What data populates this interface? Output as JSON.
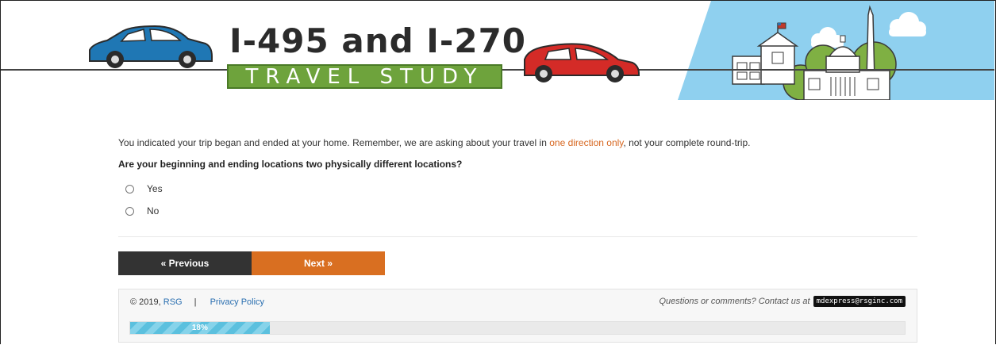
{
  "header": {
    "title_main": "I-495 and I-270",
    "title_sub": "TRAVEL STUDY"
  },
  "question": {
    "intro_before": "You indicated your trip began and ended at your home. Remember, we are asking about your travel in ",
    "intro_highlight": "one direction only",
    "intro_after": ", not your complete round-trip.",
    "text": "Are your beginning and ending locations two physically different locations?",
    "options": [
      {
        "label": "Yes",
        "selected": false
      },
      {
        "label": "No",
        "selected": false
      }
    ]
  },
  "nav": {
    "previous_label": "« Previous",
    "next_label": "Next »"
  },
  "footer": {
    "copyright": "© 2019,",
    "org_link": "RSG",
    "separator": "|",
    "privacy_label": "Privacy Policy",
    "contact_text": "Questions or comments? Contact us at",
    "email": "mdexpress@rsginc.com"
  },
  "progress": {
    "label": "18%",
    "fraction": 0.18
  },
  "colors": {
    "accent_orange": "#d96f21",
    "dark_button": "#333333",
    "title_green": "#6ea33c",
    "sky_blue": "#8fd0ef",
    "progress_blue": "#5bc0de",
    "link_blue": "#2a6fb0"
  },
  "icons": [
    "blue-car-icon",
    "red-car-icon",
    "capitol-skyline-icon",
    "cloud-icon",
    "flag-icon"
  ]
}
